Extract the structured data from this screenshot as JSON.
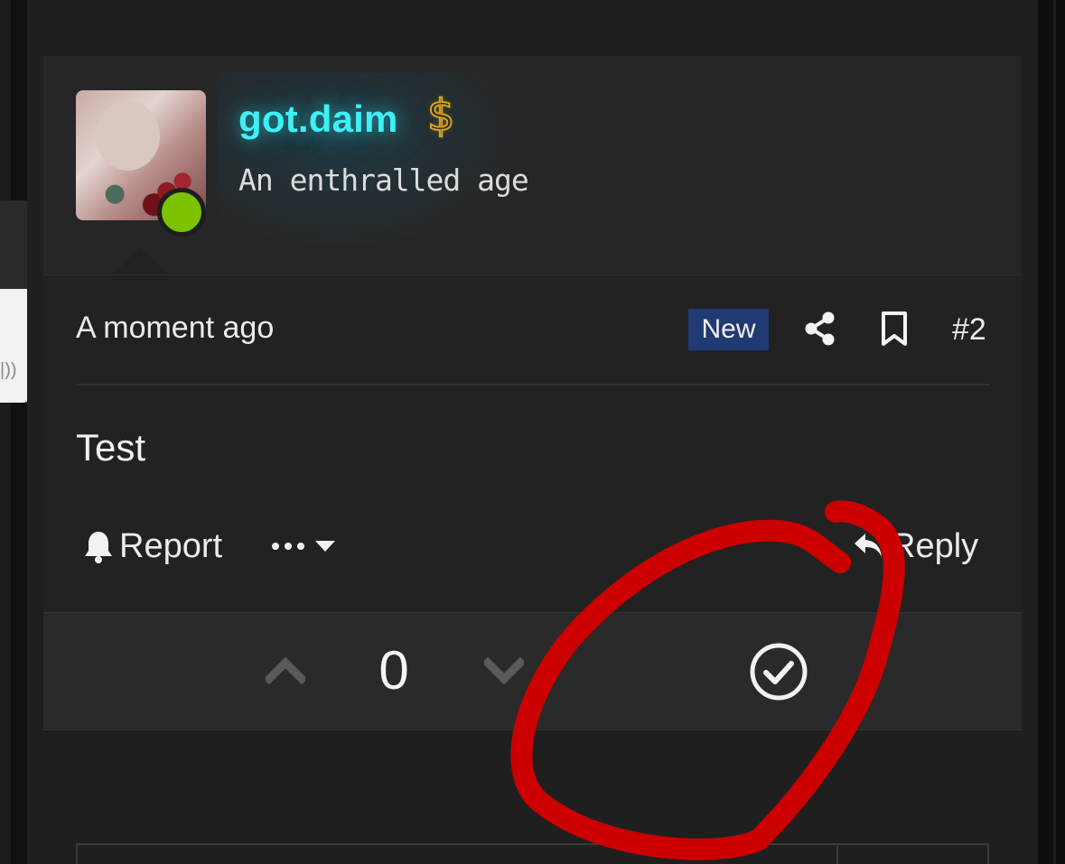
{
  "post": {
    "author": {
      "username": "got.daim",
      "badge_icon": "dollar-icon",
      "badge_symbol": "$",
      "title": "An enthralled age",
      "online": true,
      "presence_color": "#7cc200",
      "username_color": "#3ff0f5"
    },
    "meta": {
      "timestamp": "A moment ago",
      "new_label": "New",
      "post_number": "#2",
      "new_badge_color": "#213a73"
    },
    "body": "Test",
    "actions": {
      "report_label": "Report",
      "reply_label": "Reply"
    },
    "votes": {
      "score": "0"
    }
  },
  "icons": {
    "share": "share-icon",
    "bookmark": "bookmark-icon",
    "bell": "bell-icon",
    "more": "ellipsis-icon",
    "caret": "caret-down-icon",
    "reply": "reply-icon",
    "upvote": "chevron-up-icon",
    "downvote": "chevron-down-icon",
    "solution": "check-circle-icon"
  },
  "annotation": {
    "color": "#cc0000"
  },
  "side_widget": {
    "glyph": "|))"
  }
}
